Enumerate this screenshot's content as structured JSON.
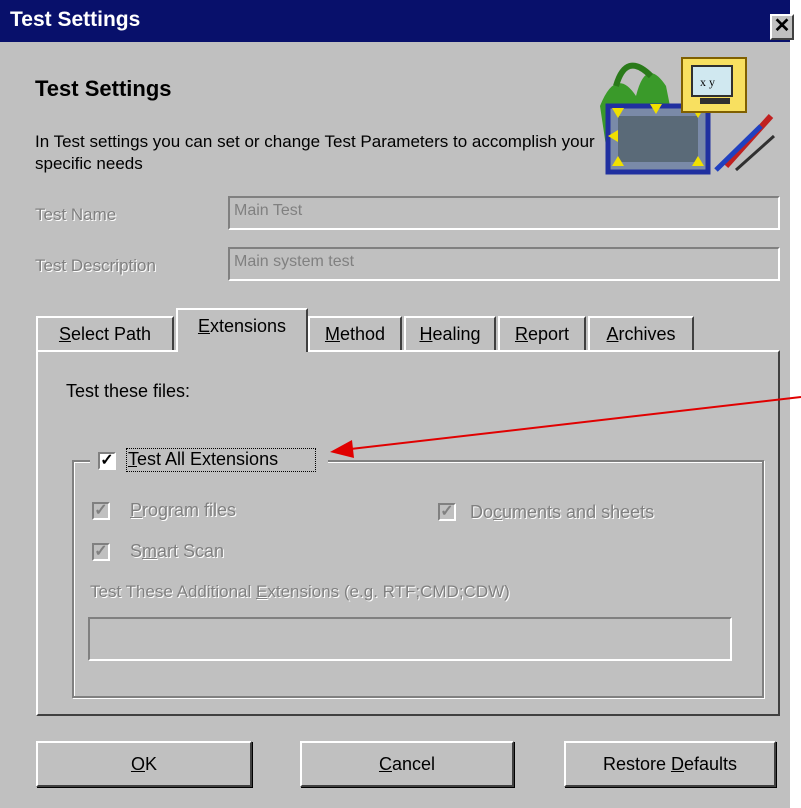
{
  "window": {
    "title": "Test Settings",
    "close_glyph": "✕"
  },
  "header": {
    "heading": "Test Settings",
    "description": "In Test settings you can set or change Test Parameters to accomplish your specific needs",
    "logo_icon": "test-settings-monitor-icon"
  },
  "fields": {
    "name_label": "Test Name",
    "name_value": "Main Test",
    "description_label": "Test Description",
    "description_value": "Main system test"
  },
  "tabs": [
    {
      "label": "Select Path",
      "mnemonic": "S",
      "rest": "elect Path"
    },
    {
      "label": "Extensions",
      "mnemonic": "E",
      "rest": "xtensions"
    },
    {
      "label": "Method",
      "mnemonic": "M",
      "rest": "ethod"
    },
    {
      "label": "Healing",
      "mnemonic": "H",
      "rest": "ealing"
    },
    {
      "label": "Report",
      "mnemonic": "R",
      "rest": "eport"
    },
    {
      "label": "Archives",
      "mnemonic": "A",
      "rest": "rchives"
    }
  ],
  "extensions": {
    "prompt": "Test these files:",
    "test_all": {
      "label": "Test All Extensions",
      "mnemonic": "T",
      "rest": "est All Extensions",
      "checked": true
    },
    "program_files": {
      "label": "Program files",
      "mnemonic": "P",
      "rest": "rogram files",
      "checked": true
    },
    "documents": {
      "label": "Documents and sheets",
      "pre": "Do",
      "mnemonic": "c",
      "rest": "uments and sheets",
      "checked": true
    },
    "smart_scan": {
      "label": "Smart Scan",
      "pre": "S",
      "mnemonic": "m",
      "rest": "art Scan",
      "checked": true
    },
    "additional_label": "Test These Additional Extensions (e.g. RTF;CMD;CDW)",
    "additional_pre": "Test These Additional ",
    "additional_mnemonic": "E",
    "additional_rest": "xtensions (e.g. RTF;CMD;CDW)",
    "additional_value": "",
    "check_glyph": "✓"
  },
  "buttons": {
    "ok": {
      "mnemonic": "O",
      "rest": "K"
    },
    "cancel": {
      "mnemonic": "C",
      "rest": "ancel"
    },
    "restore": {
      "pre": "Restore ",
      "mnemonic": "D",
      "rest": "efaults"
    }
  },
  "colors": {
    "titlebar": "#08106b",
    "dialog": "#c0c0c0",
    "annotation_arrow": "#e00000"
  }
}
